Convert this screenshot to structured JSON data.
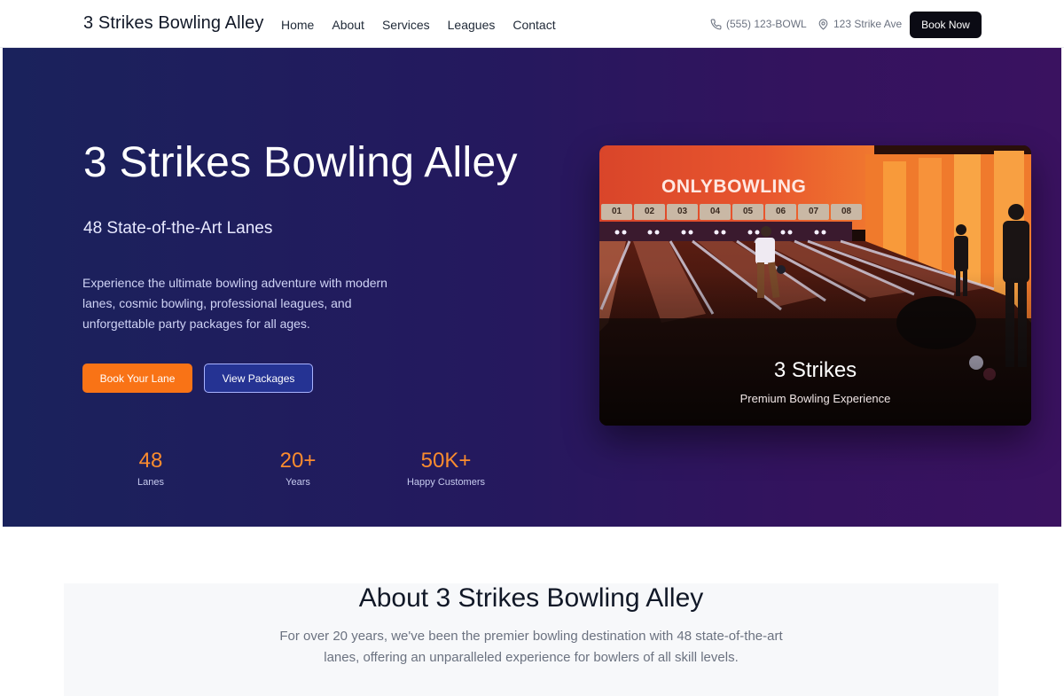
{
  "header": {
    "brand": "3 Strikes Bowling Alley",
    "nav": [
      {
        "label": "Home"
      },
      {
        "label": "About"
      },
      {
        "label": "Services"
      },
      {
        "label": "Leagues"
      },
      {
        "label": "Contact"
      }
    ],
    "phone": "(555) 123-BOWL",
    "address": "123 Strike Ave",
    "cta_label": "Book Now",
    "icons": {
      "phone": "phone-icon",
      "location": "map-pin-icon"
    }
  },
  "hero": {
    "title": "3 Strikes Bowling Alley",
    "subtitle": "48 State-of-the-Art Lanes",
    "description": "Experience the ultimate bowling adventure with modern lanes, cosmic bowling, professional leagues, and unforgettable party packages for all ages.",
    "primary_button": "Book Your Lane",
    "secondary_button": "View Packages",
    "stats": [
      {
        "value": "48",
        "label": "Lanes"
      },
      {
        "value": "20+",
        "label": "Years"
      },
      {
        "value": "50K+",
        "label": "Happy Customers"
      }
    ],
    "image": {
      "caption_title": "3 Strikes",
      "caption_subtitle": "Premium Bowling Experience",
      "sign": "ONLYBOWLING",
      "lane_numbers": [
        "01",
        "02",
        "03",
        "04",
        "05",
        "06",
        "07",
        "08"
      ]
    }
  },
  "about": {
    "title": "About 3 Strikes Bowling Alley",
    "text": "For over 20 years, we've been the premier bowling destination with 48 state-of-the-art lanes, offering an unparalleled experience for bowlers of all skill levels."
  },
  "colors": {
    "accent": "#f97316",
    "stat": "#fb8c2e",
    "hero_start": "#1a225c",
    "hero_end": "#3a1260",
    "cta_dark": "#0b0b14",
    "secondary_button": "#253393"
  }
}
